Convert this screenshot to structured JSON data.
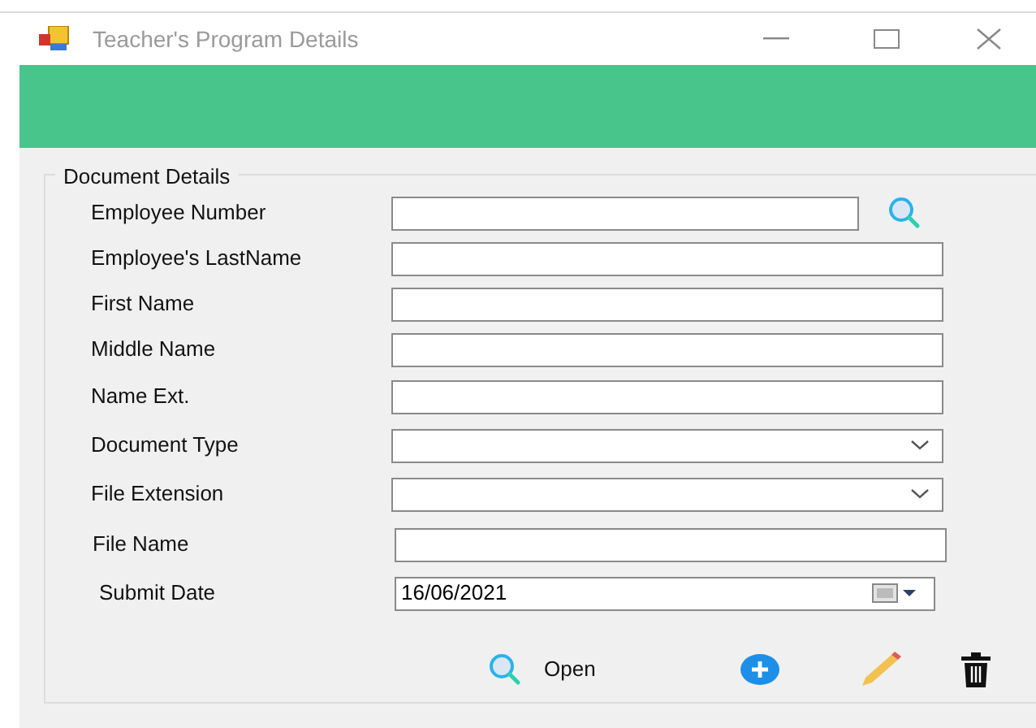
{
  "window": {
    "title": "Teacher's Program Details"
  },
  "group": {
    "title": "Document Details"
  },
  "fields": [
    {
      "label": "Employee Number",
      "kind": "search"
    },
    {
      "label": "Employee's LastName",
      "kind": "text"
    },
    {
      "label": "First Name",
      "kind": "text"
    },
    {
      "label": "Middle Name",
      "kind": "text"
    },
    {
      "label": "Name Ext.",
      "kind": "text"
    },
    {
      "label": "Document Type",
      "kind": "combo"
    },
    {
      "label": "File Extension",
      "kind": "combo"
    },
    {
      "label": "File Name",
      "kind": "text"
    },
    {
      "label": "Submit Date",
      "kind": "date",
      "value": "16/06/2021"
    }
  ],
  "actions": [
    {
      "kind": "open",
      "label": "Open"
    },
    {
      "kind": "add"
    },
    {
      "kind": "edit"
    },
    {
      "kind": "delete"
    }
  ]
}
